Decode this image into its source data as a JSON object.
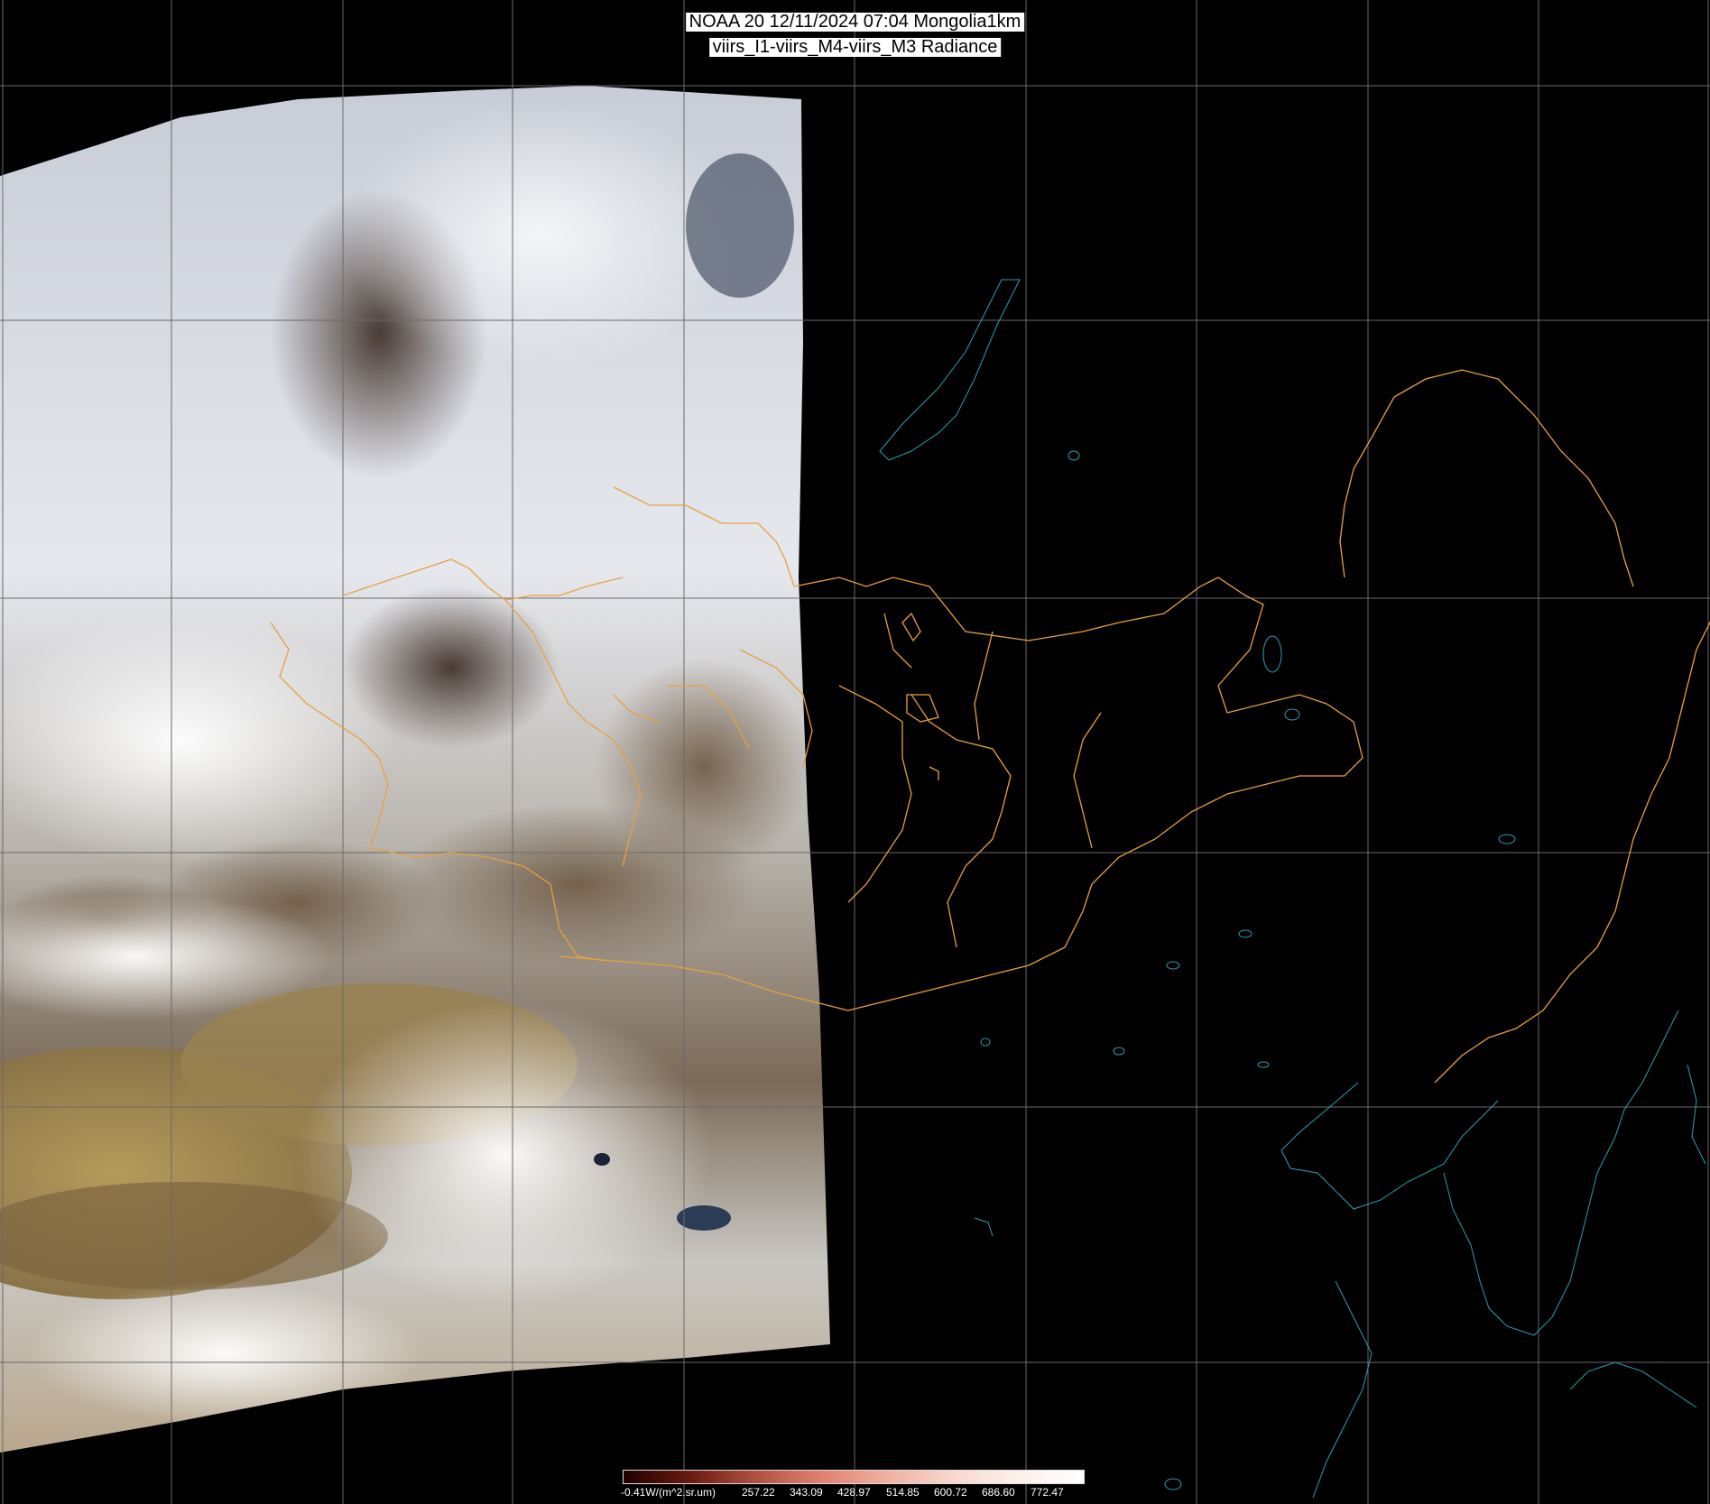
{
  "header": {
    "line1": "NOAA 20 12/11/2024 07:04 Mongolia1km",
    "line2": "viirs_I1-viirs_M4-viirs_M3 Radiance"
  },
  "colorbar": {
    "labels": [
      "-0.41W/(m^2.sr.um)",
      "257.22",
      "343.09",
      "428.97",
      "514.85",
      "600.72",
      "686.60",
      "772.47"
    ],
    "colors": [
      "#200000",
      "#6a1a10",
      "#b05040",
      "#e08070",
      "#f0b0a0",
      "#f8d8d0",
      "#fdf0ec",
      "#ffffff"
    ]
  },
  "map": {
    "background_color": "#000000",
    "grid_color": "#6a6a6a",
    "border_color": "#e8a040",
    "coast_color": "#2aa0b0"
  }
}
